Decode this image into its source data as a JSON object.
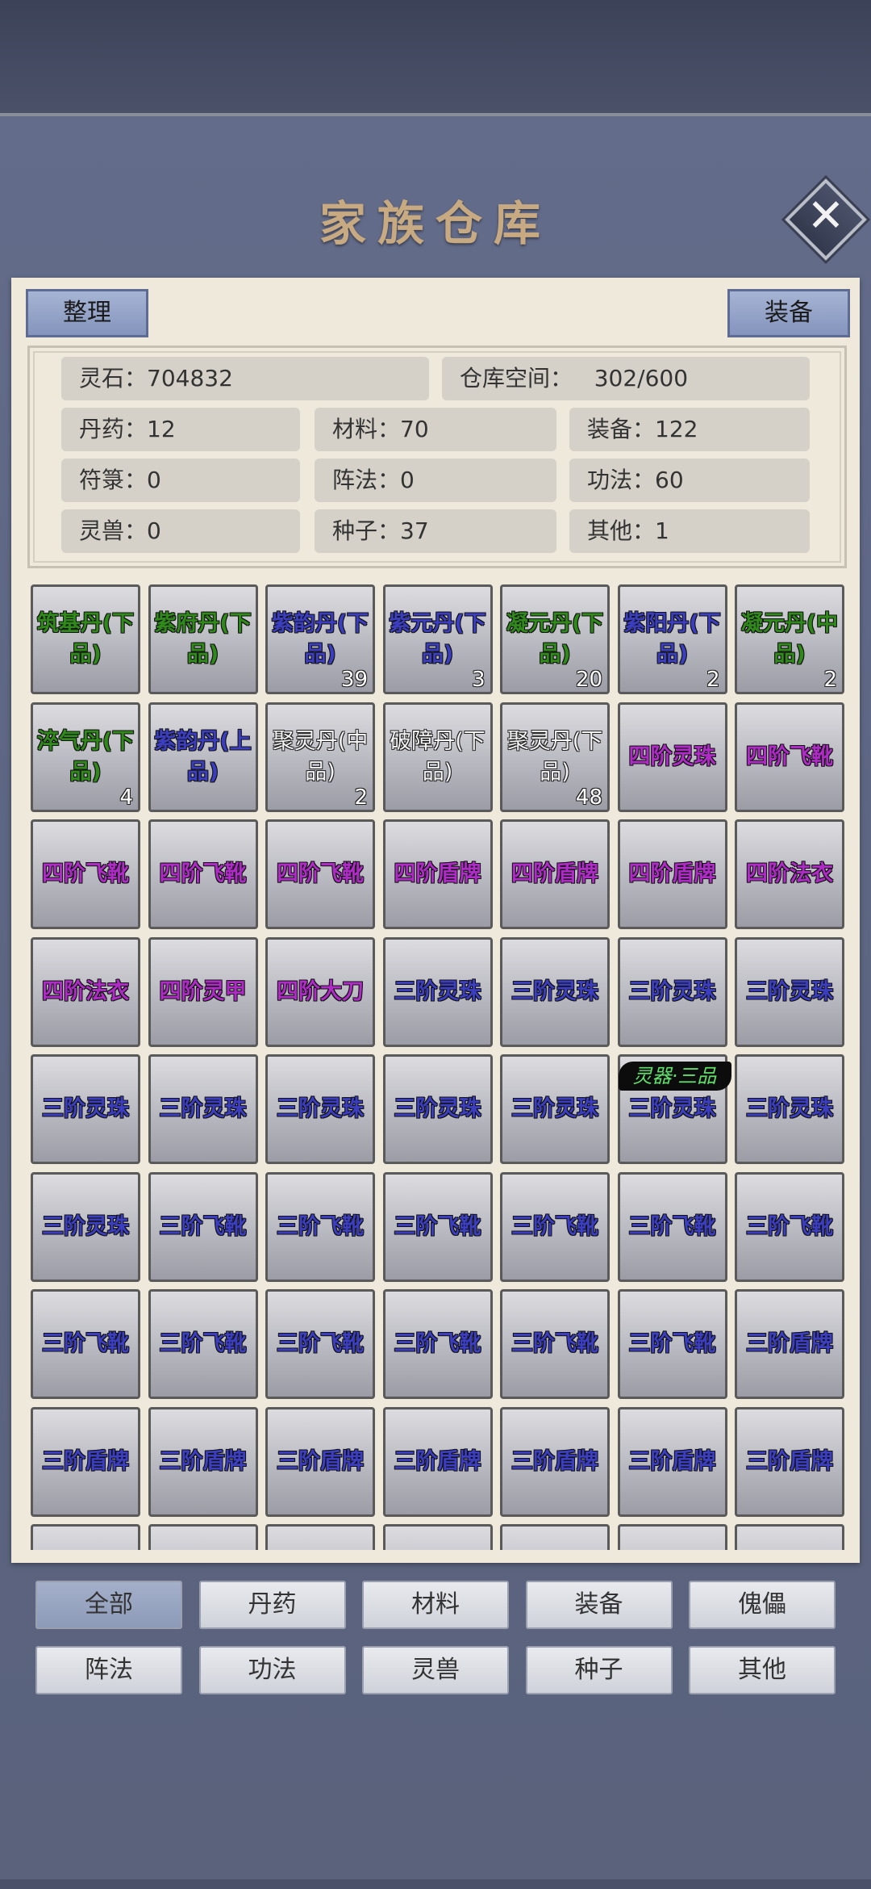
{
  "title": "家族仓库",
  "buttons": {
    "organize": "整理",
    "equip": "装备"
  },
  "stats": {
    "spirit_stone_label": "灵石：",
    "spirit_stone_value": "704832",
    "storage_label": "仓库空间：",
    "storage_value": "302/600",
    "pills": "丹药：12",
    "materials": "材料：70",
    "equipment": "装备：122",
    "talismans": "符箓：0",
    "formations": "阵法：0",
    "techniques": "功法：60",
    "beasts": "灵兽：0",
    "seeds": "种子：37",
    "others": "其他：1"
  },
  "items": [
    {
      "name": "筑基丹(下品)",
      "quality": "green",
      "count": ""
    },
    {
      "name": "紫府丹(下品)",
      "quality": "green",
      "count": ""
    },
    {
      "name": "紫韵丹(下品)",
      "quality": "blue",
      "count": "39"
    },
    {
      "name": "紫元丹(下品)",
      "quality": "blue",
      "count": "3"
    },
    {
      "name": "凝元丹(下品)",
      "quality": "green",
      "count": "20"
    },
    {
      "name": "紫阳丹(下品)",
      "quality": "blue",
      "count": "2"
    },
    {
      "name": "凝元丹(中品)",
      "quality": "green",
      "count": "2"
    },
    {
      "name": "淬气丹(下品)",
      "quality": "green",
      "count": "4"
    },
    {
      "name": "紫韵丹(上品)",
      "quality": "blue",
      "count": ""
    },
    {
      "name": "聚灵丹(中品)",
      "quality": "white",
      "count": "2"
    },
    {
      "name": "破障丹(下品)",
      "quality": "white",
      "count": ""
    },
    {
      "name": "聚灵丹(下品)",
      "quality": "white",
      "count": "48"
    },
    {
      "name": "四阶灵珠",
      "quality": "purple",
      "count": ""
    },
    {
      "name": "四阶飞靴",
      "quality": "purple",
      "count": ""
    },
    {
      "name": "四阶飞靴",
      "quality": "purple",
      "count": ""
    },
    {
      "name": "四阶飞靴",
      "quality": "purple",
      "count": ""
    },
    {
      "name": "四阶飞靴",
      "quality": "purple",
      "count": ""
    },
    {
      "name": "四阶盾牌",
      "quality": "purple",
      "count": ""
    },
    {
      "name": "四阶盾牌",
      "quality": "purple",
      "count": ""
    },
    {
      "name": "四阶盾牌",
      "quality": "purple",
      "count": ""
    },
    {
      "name": "四阶法衣",
      "quality": "purple",
      "count": ""
    },
    {
      "name": "四阶法衣",
      "quality": "purple",
      "count": ""
    },
    {
      "name": "四阶灵甲",
      "quality": "purple",
      "count": ""
    },
    {
      "name": "四阶大刀",
      "quality": "purple",
      "count": ""
    },
    {
      "name": "三阶灵珠",
      "quality": "blue",
      "count": ""
    },
    {
      "name": "三阶灵珠",
      "quality": "blue",
      "count": ""
    },
    {
      "name": "三阶灵珠",
      "quality": "blue",
      "count": ""
    },
    {
      "name": "三阶灵珠",
      "quality": "blue",
      "count": ""
    },
    {
      "name": "三阶灵珠",
      "quality": "blue",
      "count": ""
    },
    {
      "name": "三阶灵珠",
      "quality": "blue",
      "count": ""
    },
    {
      "name": "三阶灵珠",
      "quality": "blue",
      "count": ""
    },
    {
      "name": "三阶灵珠",
      "quality": "blue",
      "count": ""
    },
    {
      "name": "三阶灵珠",
      "quality": "blue",
      "count": ""
    },
    {
      "name": "三阶灵珠",
      "quality": "blue",
      "count": "",
      "tag": "灵器·三品"
    },
    {
      "name": "三阶灵珠",
      "quality": "blue",
      "count": ""
    },
    {
      "name": "三阶灵珠",
      "quality": "blue",
      "count": ""
    },
    {
      "name": "三阶飞靴",
      "quality": "blue",
      "count": ""
    },
    {
      "name": "三阶飞靴",
      "quality": "blue",
      "count": ""
    },
    {
      "name": "三阶飞靴",
      "quality": "blue",
      "count": ""
    },
    {
      "name": "三阶飞靴",
      "quality": "blue",
      "count": ""
    },
    {
      "name": "三阶飞靴",
      "quality": "blue",
      "count": ""
    },
    {
      "name": "三阶飞靴",
      "quality": "blue",
      "count": ""
    },
    {
      "name": "三阶飞靴",
      "quality": "blue",
      "count": ""
    },
    {
      "name": "三阶飞靴",
      "quality": "blue",
      "count": ""
    },
    {
      "name": "三阶飞靴",
      "quality": "blue",
      "count": ""
    },
    {
      "name": "三阶飞靴",
      "quality": "blue",
      "count": ""
    },
    {
      "name": "三阶飞靴",
      "quality": "blue",
      "count": ""
    },
    {
      "name": "三阶飞靴",
      "quality": "blue",
      "count": ""
    },
    {
      "name": "三阶盾牌",
      "quality": "blue",
      "count": ""
    },
    {
      "name": "三阶盾牌",
      "quality": "blue",
      "count": ""
    },
    {
      "name": "三阶盾牌",
      "quality": "blue",
      "count": ""
    },
    {
      "name": "三阶盾牌",
      "quality": "blue",
      "count": ""
    },
    {
      "name": "三阶盾牌",
      "quality": "blue",
      "count": ""
    },
    {
      "name": "三阶盾牌",
      "quality": "blue",
      "count": ""
    },
    {
      "name": "三阶盾牌",
      "quality": "blue",
      "count": ""
    },
    {
      "name": "三阶盾牌",
      "quality": "blue",
      "count": ""
    },
    {
      "name": "",
      "quality": "blue",
      "count": ""
    },
    {
      "name": "",
      "quality": "blue",
      "count": ""
    },
    {
      "name": "",
      "quality": "blue",
      "count": ""
    },
    {
      "name": "",
      "quality": "blue",
      "count": ""
    },
    {
      "name": "",
      "quality": "blue",
      "count": ""
    },
    {
      "name": "",
      "quality": "blue",
      "count": ""
    },
    {
      "name": "",
      "quality": "blue",
      "count": ""
    }
  ],
  "filters": [
    {
      "label": "全部",
      "active": true
    },
    {
      "label": "丹药",
      "active": false
    },
    {
      "label": "材料",
      "active": false
    },
    {
      "label": "装备",
      "active": false
    },
    {
      "label": "傀儡",
      "active": false
    },
    {
      "label": "阵法",
      "active": false
    },
    {
      "label": "功法",
      "active": false
    },
    {
      "label": "灵兽",
      "active": false
    },
    {
      "label": "种子",
      "active": false
    },
    {
      "label": "其他",
      "active": false
    }
  ],
  "icons": {
    "close": "close-icon"
  }
}
